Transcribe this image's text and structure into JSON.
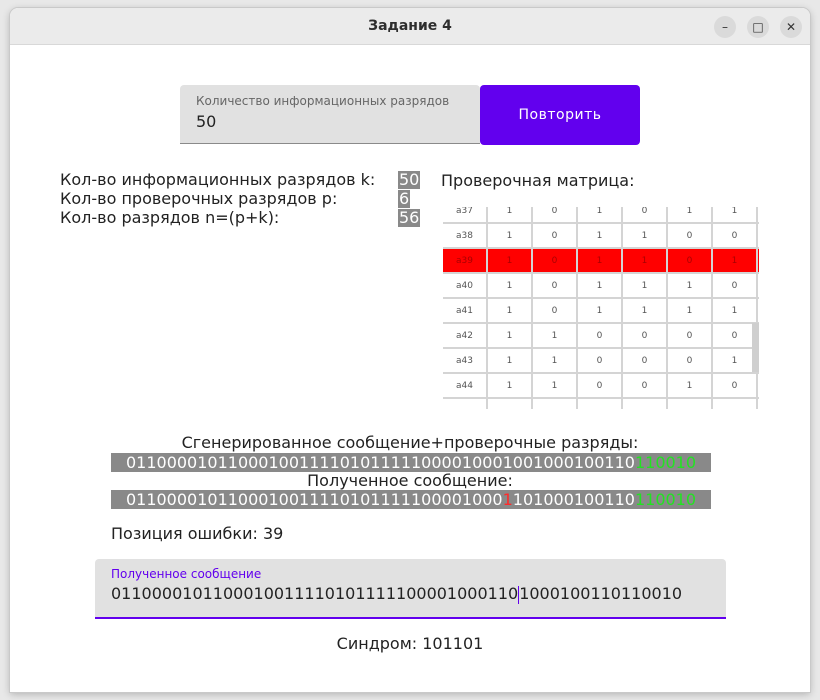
{
  "window": {
    "title": "Задание 4"
  },
  "controls": {
    "count_label": "Количество информационных разрядов",
    "count_value": "50",
    "repeat_label": "Повторить"
  },
  "info": {
    "k_label": "Кол-во информационных разрядов k:",
    "k_value": "50",
    "p_label": "Кол-во проверочных разрядов p:",
    "p_value": "6",
    "n_label": "Кол-во разрядов n=(p+k):",
    "n_value": "56"
  },
  "matrix": {
    "title": "Проверочная матрица:",
    "highlight_row": "a39",
    "rows": [
      {
        "label": "a37",
        "values": [
          "1",
          "0",
          "1",
          "0",
          "1",
          "1"
        ]
      },
      {
        "label": "a38",
        "values": [
          "1",
          "0",
          "1",
          "1",
          "0",
          "0"
        ]
      },
      {
        "label": "a39",
        "values": [
          "1",
          "0",
          "1",
          "1",
          "0",
          "1"
        ]
      },
      {
        "label": "a40",
        "values": [
          "1",
          "0",
          "1",
          "1",
          "1",
          "0"
        ]
      },
      {
        "label": "a41",
        "values": [
          "1",
          "0",
          "1",
          "1",
          "1",
          "1"
        ]
      },
      {
        "label": "a42",
        "values": [
          "1",
          "1",
          "0",
          "0",
          "0",
          "0"
        ]
      },
      {
        "label": "a43",
        "values": [
          "1",
          "1",
          "0",
          "0",
          "0",
          "1"
        ]
      },
      {
        "label": "a44",
        "values": [
          "1",
          "1",
          "0",
          "0",
          "1",
          "0"
        ]
      }
    ]
  },
  "generated": {
    "title": "Сгенерированное сообщение+проверочные разряды:",
    "info_bits": "01100001011000100111101011111000010001001000100110",
    "check_bits": "110010"
  },
  "received": {
    "title": "Полученное сообщение:",
    "before_error": "0110000101100010011110101111100001000",
    "error_bit": "1",
    "after_error": "101000100110",
    "check_bits": "110010"
  },
  "error_position": "Позиция ошибки: 39",
  "received_field": {
    "label": "Полученное сообщение",
    "value_before_caret": "0110000101100010011110101111100001000110",
    "value_after_caret": "1000100110110010"
  },
  "syndrome": "Синдром: 101101",
  "colors": {
    "accent": "#6200ee",
    "check_bits": "#22e322",
    "error": "#ff2a2a",
    "highlight": "#ff0000"
  }
}
